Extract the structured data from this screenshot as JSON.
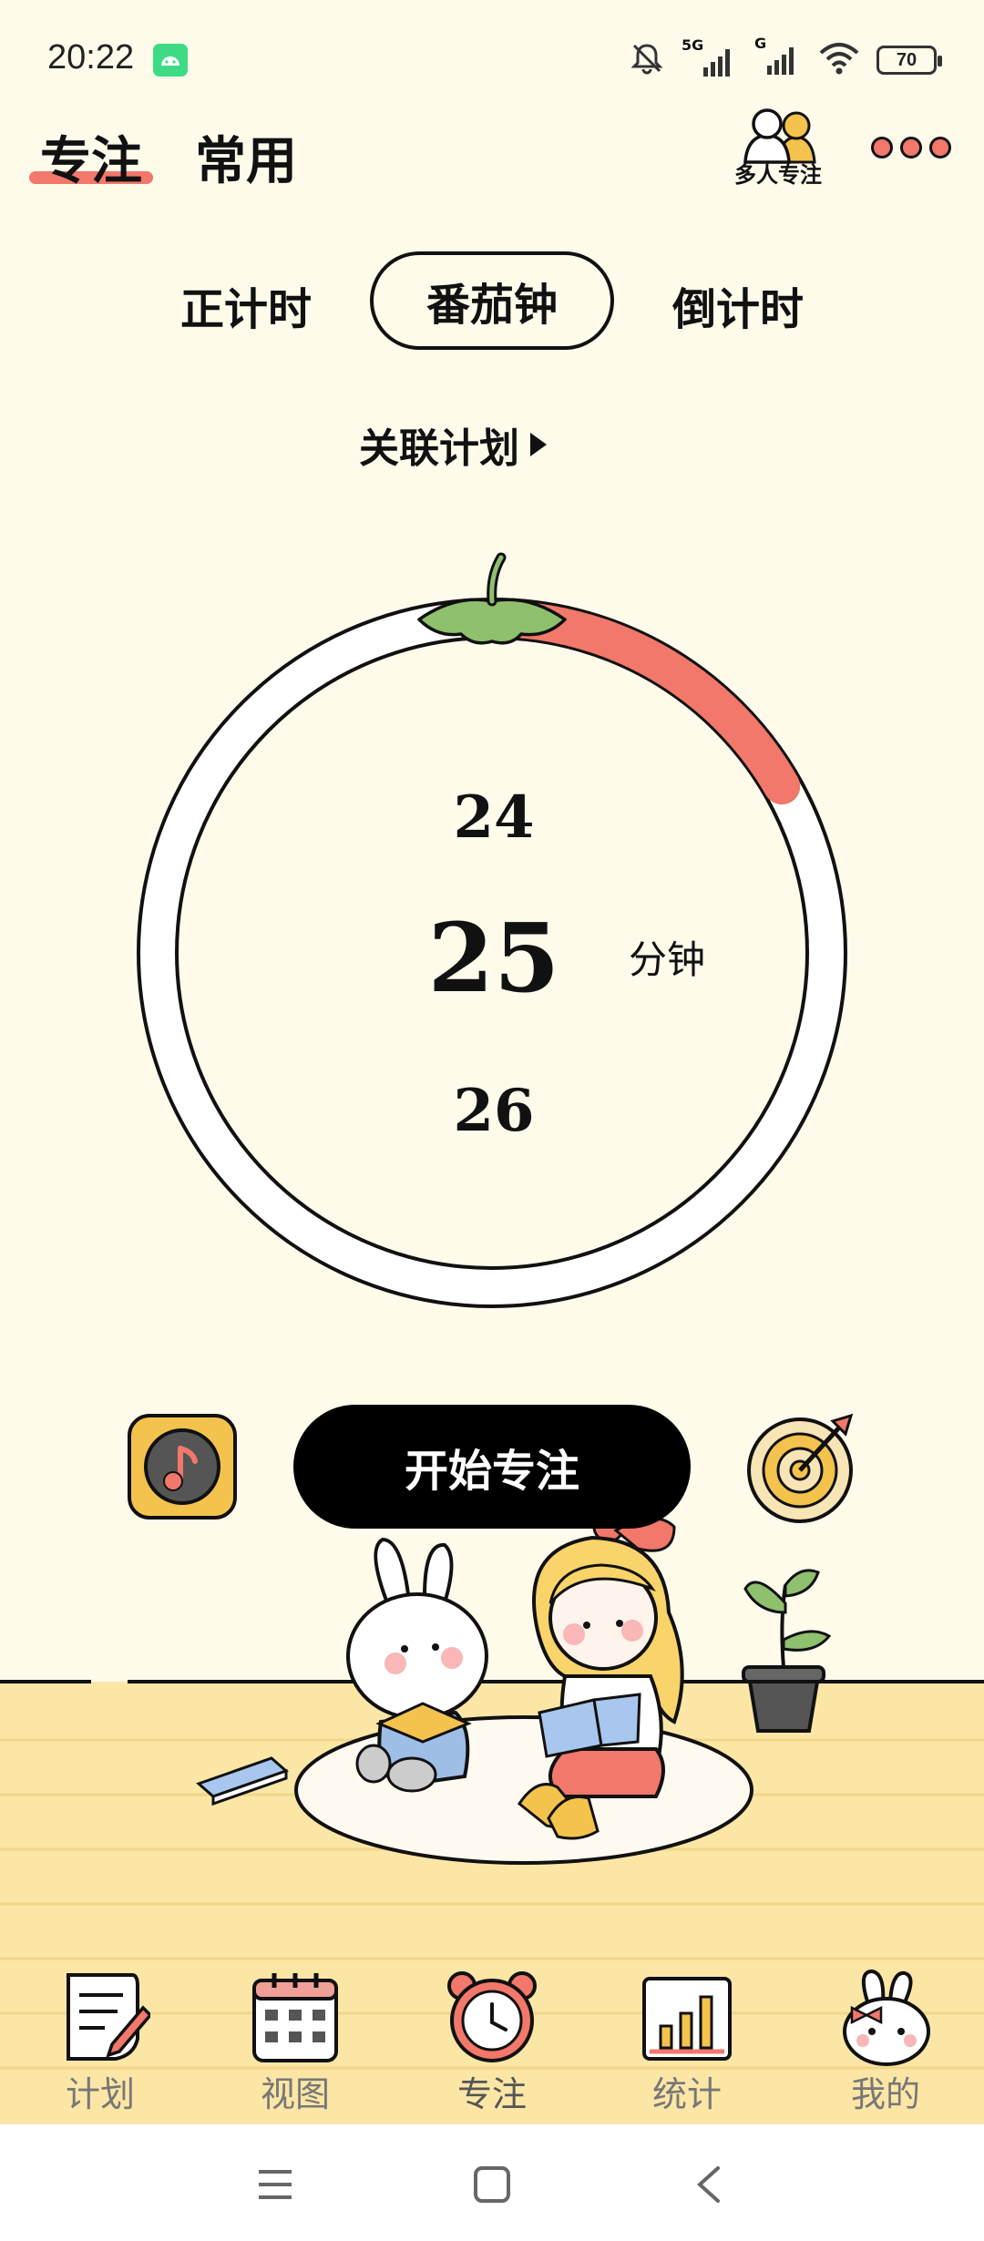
{
  "status_bar": {
    "time": "20:22",
    "network_1": "5G",
    "network_2": "G",
    "battery": "70",
    "icons": [
      "android-icon",
      "mute-icon",
      "signal-icon",
      "wifi-icon",
      "battery-icon"
    ]
  },
  "header": {
    "tabs": [
      {
        "label": "专注",
        "active": true
      },
      {
        "label": "常用",
        "active": false
      }
    ],
    "multi_focus_label": "多人专注",
    "more_icon": "more-dots-icon",
    "accent": "#f1786a"
  },
  "modes": [
    {
      "label": "正计时",
      "active": false
    },
    {
      "label": "番茄钟",
      "active": true
    },
    {
      "label": "倒计时",
      "active": false
    }
  ],
  "plan_link": "关联计划",
  "timer": {
    "prev": "24",
    "current": "25",
    "next": "26",
    "unit": "分钟",
    "progress": 0.167,
    "progress_color": "#f1786a"
  },
  "controls": {
    "music_icon": "music-note-icon",
    "start_label": "开始专注",
    "target_icon": "target-icon"
  },
  "bottom_nav": [
    {
      "label": "计划",
      "icon": "plan-scroll-icon",
      "active": false
    },
    {
      "label": "视图",
      "icon": "calendar-icon",
      "active": false
    },
    {
      "label": "专注",
      "icon": "alarm-clock-icon",
      "active": true
    },
    {
      "label": "统计",
      "icon": "bar-chart-icon",
      "active": false
    },
    {
      "label": "我的",
      "icon": "bunny-face-icon",
      "active": false
    }
  ],
  "system_nav": [
    "menu-icon",
    "home-icon",
    "back-icon"
  ]
}
